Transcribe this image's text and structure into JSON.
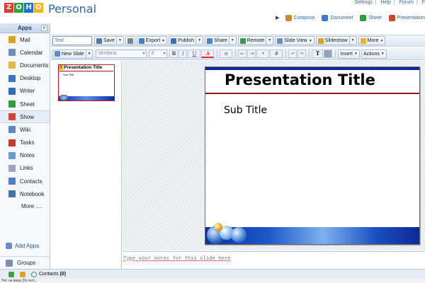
{
  "header": {
    "logo_letters": [
      "Z",
      "O",
      "H",
      "O"
    ],
    "logo_colors": [
      "#e03a2d",
      "#2f9e44",
      "#1f6fd0",
      "#f2b51b"
    ],
    "brand": "Personal",
    "top_links": [
      "Settings",
      "Help",
      "Forum",
      "F"
    ],
    "quick_links": [
      {
        "label": "Compose",
        "icon": "compose-icon"
      },
      {
        "label": "Document",
        "icon": "document-icon"
      },
      {
        "label": "Sheet",
        "icon": "sheet-icon"
      },
      {
        "label": "Presentation",
        "icon": "presentation-icon"
      }
    ]
  },
  "sidebar": {
    "title": "Apps",
    "collapse_glyph": "«",
    "items": [
      {
        "label": "Mail",
        "icon": "mail-icon",
        "color": "#d9a520"
      },
      {
        "label": "Calendar",
        "icon": "calendar-icon",
        "color": "#6d8fb8"
      },
      {
        "label": "Documents",
        "icon": "documents-icon",
        "color": "#e6b844"
      },
      {
        "label": "Desktop",
        "icon": "desktop-icon",
        "color": "#3a73c9"
      },
      {
        "label": "Writer",
        "icon": "writer-icon",
        "color": "#2f6cc0"
      },
      {
        "label": "Sheet",
        "icon": "sheet-icon",
        "color": "#2e9b3e"
      },
      {
        "label": "Show",
        "icon": "show-icon",
        "color": "#d4442f",
        "active": true
      },
      {
        "label": "Wiki",
        "icon": "wiki-icon",
        "color": "#5f86c3"
      },
      {
        "label": "Tasks",
        "icon": "tasks-icon",
        "color": "#c8392b"
      },
      {
        "label": "Notes",
        "icon": "notes-icon",
        "color": "#6a9bd6"
      },
      {
        "label": "Links",
        "icon": "links-icon",
        "color": "#9aa7b8"
      },
      {
        "label": "Contacts",
        "icon": "contacts-icon",
        "color": "#4f7fc6"
      },
      {
        "label": "Notebook",
        "icon": "notebook-icon",
        "color": "#4a6fa8"
      }
    ],
    "more": "More ....",
    "add_apps": "Add Apps",
    "groups": "Groups"
  },
  "toolbar": {
    "doc_name": "Test",
    "buttons": [
      {
        "label": "Save",
        "icon": "save-icon",
        "dropdown": true
      },
      {
        "label": "",
        "icon": "print-icon",
        "dropdown": false
      },
      {
        "label": "Export",
        "icon": "export-icon",
        "dropdown": true
      },
      {
        "label": "Publish",
        "icon": "publish-icon",
        "dropdown": true
      },
      {
        "label": "Share",
        "icon": "share-icon",
        "dropdown": true
      },
      {
        "label": "Remote",
        "icon": "remote-icon",
        "dropdown": true
      },
      {
        "label": "Slide View",
        "icon": "slide-view-icon",
        "dropdown": true
      },
      {
        "label": "Slideshow",
        "icon": "slideshow-icon",
        "dropdown": true
      },
      {
        "label": "More",
        "icon": "more-icon",
        "dropdown": true
      }
    ],
    "new_slide": "New Slide",
    "font": "Verdana",
    "font_size": "8",
    "bold": "B",
    "italic": "I",
    "underline": "U",
    "text_color": "A",
    "text_tool": "T",
    "insert": "Insert",
    "actions": "Actions"
  },
  "thumbnail": {
    "number": "1",
    "title": "Presentation Title",
    "subtitle": "Sub Title"
  },
  "slide": {
    "title": "Presentation Title",
    "subtitle": "Sub Title"
  },
  "notes": {
    "placeholder": "Type your notes for this slide here"
  },
  "footer": {
    "contacts_label": "Contacts",
    "contacts_count": "(0)"
  },
  "status": {
    "text": "Нет на ввод (Ну вот)..."
  }
}
